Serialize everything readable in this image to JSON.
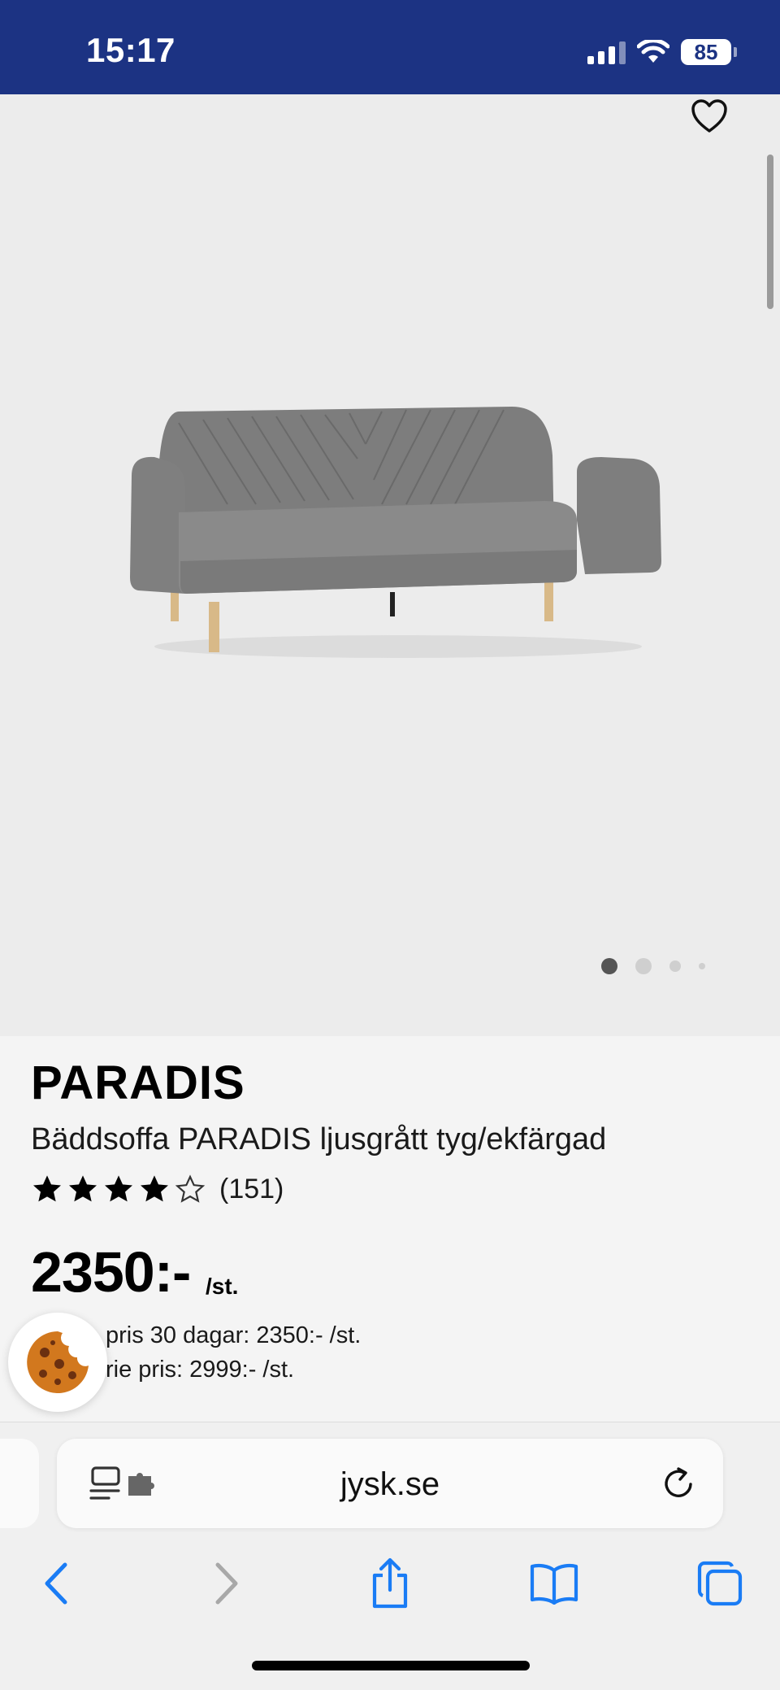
{
  "status_bar": {
    "time": "15:17",
    "battery": "85"
  },
  "product": {
    "brand": "PARADIS",
    "title": "Bäddsoffa PARADIS ljusgrått tyg/ekfärgad",
    "rating": 4,
    "rating_max": 5,
    "rating_count": "(151)",
    "price": "2350:-",
    "price_unit": "/st.",
    "lowest_price_30_days": "pris 30 dagar: 2350:- /st.",
    "ordinary_price": "rie pris: 2999:- /st.",
    "image_count": 4,
    "active_image": 1
  },
  "browser": {
    "url": "jysk.se"
  },
  "colors": {
    "status_bar": "#1c3383",
    "image_bg": "#ececec",
    "ios_blue": "#1a7cf5"
  },
  "icons": {
    "favorite": "heart-outline-icon",
    "cookie": "cookie-icon",
    "reader": "reader-mode-icon",
    "extension": "extension-icon",
    "reload": "reload-icon",
    "back": "chevron-left-icon",
    "forward": "chevron-right-icon",
    "share": "share-icon",
    "bookmarks": "book-icon",
    "tabs": "tabs-icon"
  }
}
